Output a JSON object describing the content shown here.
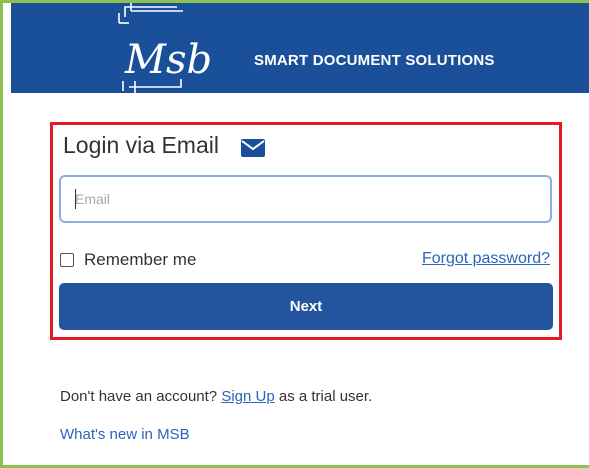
{
  "header": {
    "logo_text": "Msb",
    "tagline": "SMART DOCUMENT SOLUTIONS",
    "background_color": "#1a4f9a"
  },
  "login": {
    "title": "Login via Email",
    "title_icon": "mail-icon",
    "email_placeholder": "Email",
    "email_value": "",
    "remember_label": "Remember me",
    "remember_checked": false,
    "forgot_label": "Forgot password?",
    "next_label": "Next",
    "highlight_color": "#e41b23",
    "button_color": "#23559e"
  },
  "footer": {
    "signup_prefix": "Don't have an account? ",
    "signup_link": "Sign Up",
    "signup_suffix": " as a trial user.",
    "whats_new": "What's new in MSB"
  },
  "colors": {
    "frame_border": "#8cc152",
    "link": "#2b64b8"
  }
}
